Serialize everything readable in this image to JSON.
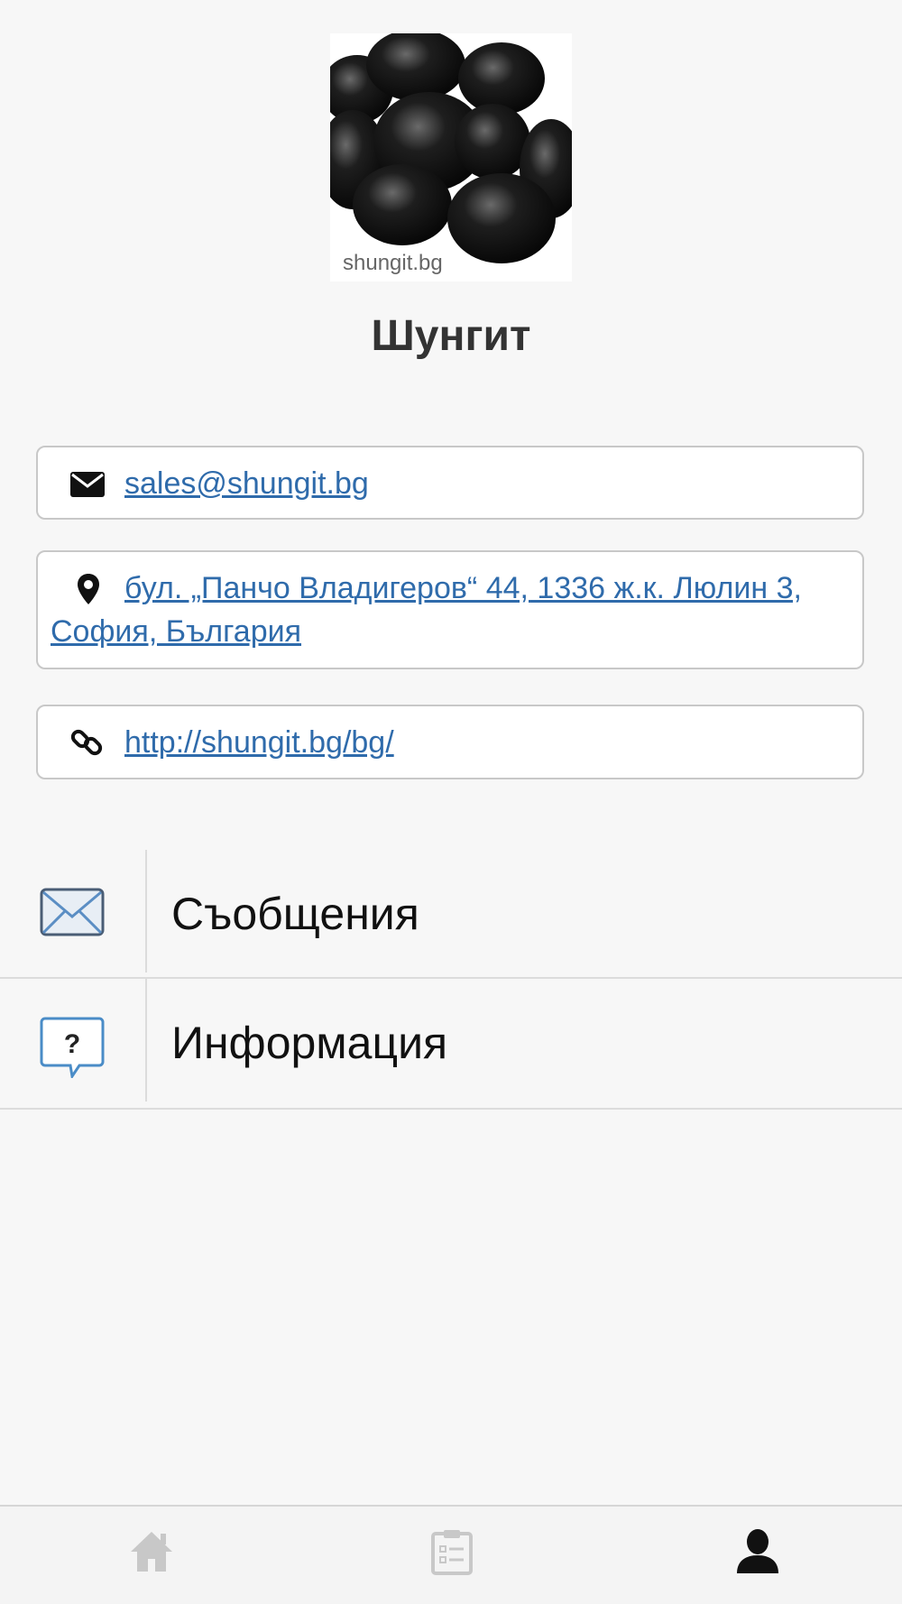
{
  "profile": {
    "logo_caption": "shungit.bg",
    "company_name": "Шунгит"
  },
  "contacts": {
    "email": "sales@shungit.bg",
    "address": "бул. „Панчо Владигеров“ 44, 1336 ж.к. Люлин 3, София, България",
    "website": "http://shungit.bg/bg/"
  },
  "menu": {
    "items": [
      {
        "label": "Съобщения",
        "icon": "envelope-icon"
      },
      {
        "label": "Информация",
        "icon": "question-bubble-icon"
      }
    ]
  },
  "tabbar": {
    "tabs": [
      {
        "icon": "home-icon",
        "active": false
      },
      {
        "icon": "clipboard-list-icon",
        "active": false
      },
      {
        "icon": "user-icon",
        "active": true
      }
    ]
  },
  "colors": {
    "link": "#2f6bab",
    "background": "#f7f7f7",
    "icon_blue": "#4a8cc7",
    "inactive_tab": "#c8c8c8",
    "active_tab": "#111111"
  }
}
